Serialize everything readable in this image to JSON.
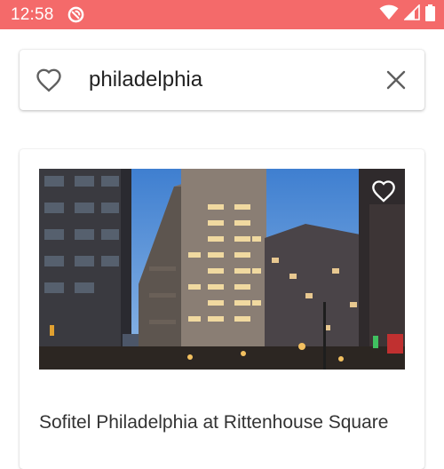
{
  "status_bar": {
    "time": "12:58",
    "background_color": "#f46a6a",
    "icons": [
      "app-notification-icon",
      "wifi-icon",
      "cellular-signal-icon",
      "battery-icon"
    ]
  },
  "search": {
    "value": "philadelphia",
    "favorite_icon": "heart-outline-icon",
    "clear_icon": "close-icon"
  },
  "results": [
    {
      "name": "Sofitel Philadelphia at Rittenhouse Square",
      "favorite_icon": "heart-outline-icon"
    }
  ]
}
